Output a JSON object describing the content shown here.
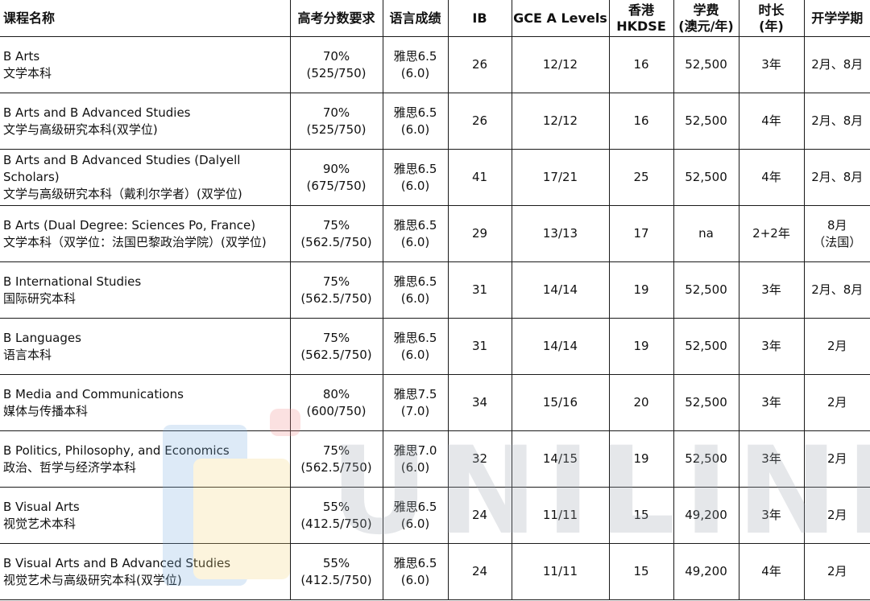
{
  "headers": {
    "name": "课程名称",
    "gaokao": "高考分数要求",
    "language": "语言成绩",
    "ib": "IB",
    "alevels": "GCE A Levels",
    "hkdse": [
      "香港",
      "HKDSE"
    ],
    "fee": [
      "学费",
      "(澳元/年)"
    ],
    "duration": [
      "时长",
      "(年)"
    ],
    "intake": "开学学期"
  },
  "rows": [
    {
      "name_en": "B Arts",
      "name_cn": "文学本科",
      "gaokao": [
        "70%",
        "(525/750)"
      ],
      "language": [
        "雅思6.5",
        "(6.0)"
      ],
      "ib": "26",
      "alevels": "12/12",
      "hkdse": "16",
      "fee": "52,500",
      "duration": "3年",
      "intake": [
        "2月、8月"
      ]
    },
    {
      "name_en": "B Arts and B Advanced Studies",
      "name_cn": "文学与高级研究本科(双学位)",
      "gaokao": [
        "70%",
        "(525/750)"
      ],
      "language": [
        "雅思6.5",
        "(6.0)"
      ],
      "ib": "26",
      "alevels": "12/12",
      "hkdse": "16",
      "fee": "52,500",
      "duration": "4年",
      "intake": [
        "2月、8月"
      ]
    },
    {
      "name_en": "B Arts and B Advanced Studies (Dalyell Scholars)",
      "name_cn": "文学与高级研究本科（戴利尔学者）(双学位)",
      "gaokao": [
        "90%",
        "(675/750)"
      ],
      "language": [
        "雅思6.5",
        "(6.0)"
      ],
      "ib": "41",
      "alevels": "17/21",
      "hkdse": "25",
      "fee": "52,500",
      "duration": "4年",
      "intake": [
        "2月、8月"
      ]
    },
    {
      "name_en": "B Arts (Dual Degree: Sciences Po, France)",
      "name_cn": "文学本科（双学位：法国巴黎政治学院）(双学位)",
      "gaokao": [
        "75%",
        "(562.5/750)"
      ],
      "language": [
        "雅思6.5",
        "(6.0)"
      ],
      "ib": "29",
      "alevels": "13/13",
      "hkdse": "17",
      "fee": "na",
      "duration": "2+2年",
      "intake": [
        "8月",
        "（法国）"
      ]
    },
    {
      "name_en": "B International Studies",
      "name_cn": "国际研究本科",
      "gaokao": [
        "75%",
        "(562.5/750)"
      ],
      "language": [
        "雅思6.5",
        "(6.0)"
      ],
      "ib": "31",
      "alevels": "14/14",
      "hkdse": "19",
      "fee": "52,500",
      "duration": "3年",
      "intake": [
        "2月、8月"
      ]
    },
    {
      "name_en": "B Languages",
      "name_cn": "语言本科",
      "gaokao": [
        "75%",
        "(562.5/750)"
      ],
      "language": [
        "雅思6.5",
        "(6.0)"
      ],
      "ib": "31",
      "alevels": "14/14",
      "hkdse": "19",
      "fee": "52,500",
      "duration": "3年",
      "intake": [
        "2月"
      ]
    },
    {
      "name_en": "B Media and Communications",
      "name_cn": "媒体与传播本科",
      "gaokao": [
        "80%",
        "(600/750)"
      ],
      "language": [
        "雅思7.5",
        "(7.0)"
      ],
      "ib": "34",
      "alevels": "15/16",
      "hkdse": "20",
      "fee": "52,500",
      "duration": "3年",
      "intake": [
        "2月"
      ]
    },
    {
      "name_en": "B Politics, Philosophy, and Economics",
      "name_cn": "政治、哲学与经济学本科",
      "gaokao": [
        "75%",
        "(562.5/750)"
      ],
      "language": [
        "雅思7.0",
        "(6.0)"
      ],
      "ib": "32",
      "alevels": "14/15",
      "hkdse": "19",
      "fee": "52,500",
      "duration": "3年",
      "intake": [
        "2月"
      ]
    },
    {
      "name_en": "B Visual Arts",
      "name_cn": "视觉艺术本科",
      "gaokao": [
        "55%",
        "(412.5/750)"
      ],
      "language": [
        "雅思6.5",
        "(6.0)"
      ],
      "ib": "24",
      "alevels": "11/11",
      "hkdse": "15",
      "fee": "49,200",
      "duration": "3年",
      "intake": [
        "2月"
      ]
    },
    {
      "name_en": "B Visual Arts and B Advanced Studies",
      "name_cn": "视觉艺术与高级研究本科(双学位)",
      "gaokao": [
        "55%",
        "(412.5/750)"
      ],
      "language": [
        "雅思6.5",
        "(6.0)"
      ],
      "ib": "24",
      "alevels": "11/11",
      "hkdse": "15",
      "fee": "49,200",
      "duration": "4年",
      "intake": [
        "2月"
      ]
    }
  ],
  "watermark": {
    "text": "UNILINK",
    "colors": [
      "#7ab0e0",
      "#f4d77a",
      "#f08a8a"
    ]
  }
}
